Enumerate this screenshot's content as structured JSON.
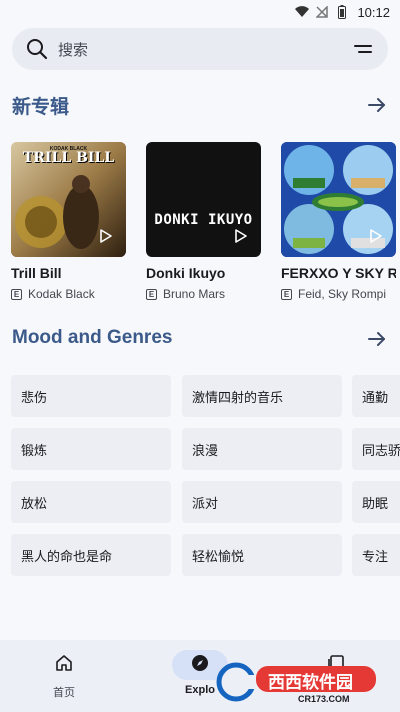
{
  "status_bar": {
    "time": "10:12"
  },
  "search": {
    "placeholder": "搜索"
  },
  "new_albums": {
    "title": "新专辑",
    "albums": [
      {
        "title": "Trill Bill",
        "artist": "Kodak Black",
        "explicit": "E",
        "cover_text": "TRILL BILL",
        "cover_small_text": "KODAK BLACK"
      },
      {
        "title": "Donki Ikuyo",
        "artist": "Bruno Mars",
        "explicit": "E",
        "cover_text": "DONKI IKUYO"
      },
      {
        "title": "FERXXO Y SKY R",
        "artist": "Feid, Sky Rompi",
        "explicit": "E"
      }
    ]
  },
  "moods": {
    "title": "Mood and Genres",
    "chips": [
      [
        "悲伤",
        "激情四射的音乐",
        "通勤"
      ],
      [
        "锻炼",
        "浪漫",
        "同志骄"
      ],
      [
        "放松",
        "派对",
        "助眠"
      ],
      [
        "黑人的命也是命",
        "轻松愉悦",
        "专注"
      ]
    ]
  },
  "bottom_nav": {
    "items": [
      {
        "label": "首页",
        "icon": "home-icon"
      },
      {
        "label": "Explo",
        "icon": "explore-icon",
        "active": true
      },
      {
        "label": "",
        "icon": "library-icon"
      }
    ]
  },
  "watermark": {
    "brand": "西西软件园",
    "url": "CR173.COM"
  },
  "colors": {
    "accent": "#3b5a8a",
    "chip_bg": "#eceef3",
    "nav_bg": "#eceff6",
    "active_pill": "#d6e1f7"
  }
}
